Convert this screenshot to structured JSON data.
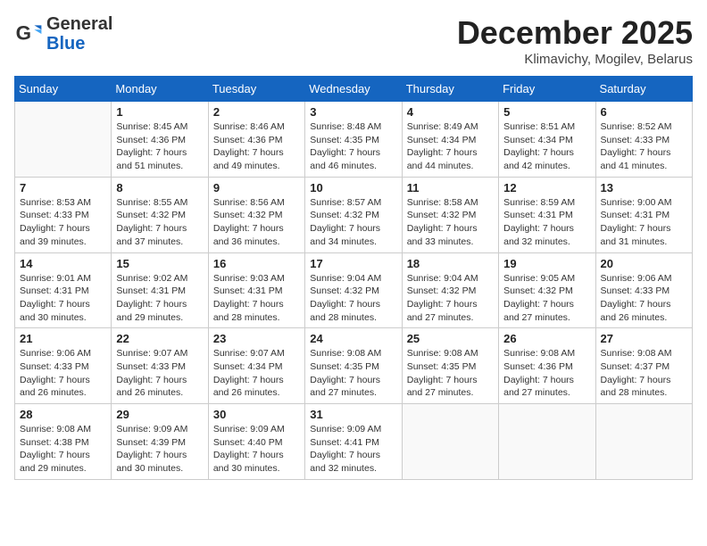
{
  "header": {
    "logo_general": "General",
    "logo_blue": "Blue",
    "month_year": "December 2025",
    "location": "Klimavichy, Mogilev, Belarus"
  },
  "weekdays": [
    "Sunday",
    "Monday",
    "Tuesday",
    "Wednesday",
    "Thursday",
    "Friday",
    "Saturday"
  ],
  "weeks": [
    [
      {
        "day": "",
        "info": ""
      },
      {
        "day": "1",
        "info": "Sunrise: 8:45 AM\nSunset: 4:36 PM\nDaylight: 7 hours\nand 51 minutes."
      },
      {
        "day": "2",
        "info": "Sunrise: 8:46 AM\nSunset: 4:36 PM\nDaylight: 7 hours\nand 49 minutes."
      },
      {
        "day": "3",
        "info": "Sunrise: 8:48 AM\nSunset: 4:35 PM\nDaylight: 7 hours\nand 46 minutes."
      },
      {
        "day": "4",
        "info": "Sunrise: 8:49 AM\nSunset: 4:34 PM\nDaylight: 7 hours\nand 44 minutes."
      },
      {
        "day": "5",
        "info": "Sunrise: 8:51 AM\nSunset: 4:34 PM\nDaylight: 7 hours\nand 42 minutes."
      },
      {
        "day": "6",
        "info": "Sunrise: 8:52 AM\nSunset: 4:33 PM\nDaylight: 7 hours\nand 41 minutes."
      }
    ],
    [
      {
        "day": "7",
        "info": "Sunrise: 8:53 AM\nSunset: 4:33 PM\nDaylight: 7 hours\nand 39 minutes."
      },
      {
        "day": "8",
        "info": "Sunrise: 8:55 AM\nSunset: 4:32 PM\nDaylight: 7 hours\nand 37 minutes."
      },
      {
        "day": "9",
        "info": "Sunrise: 8:56 AM\nSunset: 4:32 PM\nDaylight: 7 hours\nand 36 minutes."
      },
      {
        "day": "10",
        "info": "Sunrise: 8:57 AM\nSunset: 4:32 PM\nDaylight: 7 hours\nand 34 minutes."
      },
      {
        "day": "11",
        "info": "Sunrise: 8:58 AM\nSunset: 4:32 PM\nDaylight: 7 hours\nand 33 minutes."
      },
      {
        "day": "12",
        "info": "Sunrise: 8:59 AM\nSunset: 4:31 PM\nDaylight: 7 hours\nand 32 minutes."
      },
      {
        "day": "13",
        "info": "Sunrise: 9:00 AM\nSunset: 4:31 PM\nDaylight: 7 hours\nand 31 minutes."
      }
    ],
    [
      {
        "day": "14",
        "info": "Sunrise: 9:01 AM\nSunset: 4:31 PM\nDaylight: 7 hours\nand 30 minutes."
      },
      {
        "day": "15",
        "info": "Sunrise: 9:02 AM\nSunset: 4:31 PM\nDaylight: 7 hours\nand 29 minutes."
      },
      {
        "day": "16",
        "info": "Sunrise: 9:03 AM\nSunset: 4:31 PM\nDaylight: 7 hours\nand 28 minutes."
      },
      {
        "day": "17",
        "info": "Sunrise: 9:04 AM\nSunset: 4:32 PM\nDaylight: 7 hours\nand 28 minutes."
      },
      {
        "day": "18",
        "info": "Sunrise: 9:04 AM\nSunset: 4:32 PM\nDaylight: 7 hours\nand 27 minutes."
      },
      {
        "day": "19",
        "info": "Sunrise: 9:05 AM\nSunset: 4:32 PM\nDaylight: 7 hours\nand 27 minutes."
      },
      {
        "day": "20",
        "info": "Sunrise: 9:06 AM\nSunset: 4:33 PM\nDaylight: 7 hours\nand 26 minutes."
      }
    ],
    [
      {
        "day": "21",
        "info": "Sunrise: 9:06 AM\nSunset: 4:33 PM\nDaylight: 7 hours\nand 26 minutes."
      },
      {
        "day": "22",
        "info": "Sunrise: 9:07 AM\nSunset: 4:33 PM\nDaylight: 7 hours\nand 26 minutes."
      },
      {
        "day": "23",
        "info": "Sunrise: 9:07 AM\nSunset: 4:34 PM\nDaylight: 7 hours\nand 26 minutes."
      },
      {
        "day": "24",
        "info": "Sunrise: 9:08 AM\nSunset: 4:35 PM\nDaylight: 7 hours\nand 27 minutes."
      },
      {
        "day": "25",
        "info": "Sunrise: 9:08 AM\nSunset: 4:35 PM\nDaylight: 7 hours\nand 27 minutes."
      },
      {
        "day": "26",
        "info": "Sunrise: 9:08 AM\nSunset: 4:36 PM\nDaylight: 7 hours\nand 27 minutes."
      },
      {
        "day": "27",
        "info": "Sunrise: 9:08 AM\nSunset: 4:37 PM\nDaylight: 7 hours\nand 28 minutes."
      }
    ],
    [
      {
        "day": "28",
        "info": "Sunrise: 9:08 AM\nSunset: 4:38 PM\nDaylight: 7 hours\nand 29 minutes."
      },
      {
        "day": "29",
        "info": "Sunrise: 9:09 AM\nSunset: 4:39 PM\nDaylight: 7 hours\nand 30 minutes."
      },
      {
        "day": "30",
        "info": "Sunrise: 9:09 AM\nSunset: 4:40 PM\nDaylight: 7 hours\nand 30 minutes."
      },
      {
        "day": "31",
        "info": "Sunrise: 9:09 AM\nSunset: 4:41 PM\nDaylight: 7 hours\nand 32 minutes."
      },
      {
        "day": "",
        "info": ""
      },
      {
        "day": "",
        "info": ""
      },
      {
        "day": "",
        "info": ""
      }
    ]
  ]
}
